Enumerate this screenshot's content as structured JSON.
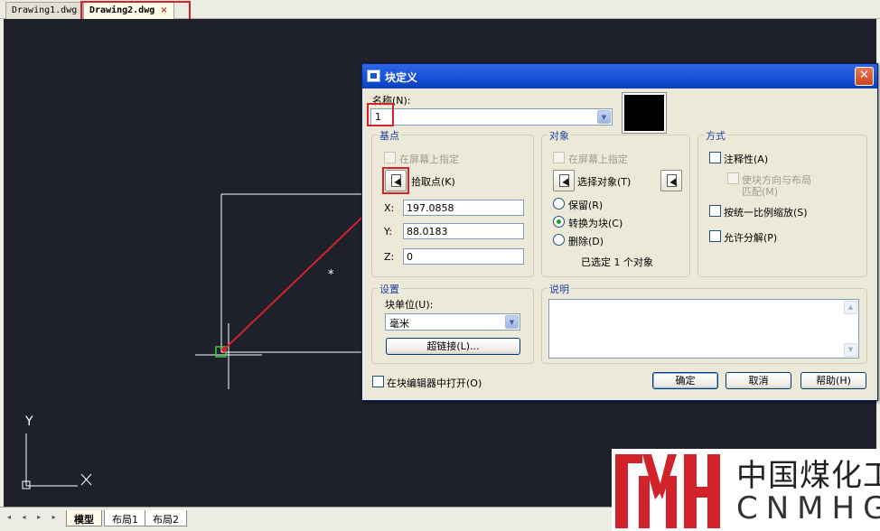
{
  "tabs": [
    {
      "label": "Drawing1.dwg",
      "active": false
    },
    {
      "label": "Drawing2.dwg",
      "active": true
    }
  ],
  "tab_close_glyph": "×",
  "canvas": {
    "ucs_y": "Y",
    "ucs_x": "X",
    "background": "#1e202c"
  },
  "layout_tabs": [
    "模型",
    "布局1",
    "布局2"
  ],
  "layout_nav": "◂ ◂ ▸ ▸",
  "dialog": {
    "title": "块定义",
    "close_glyph": "✕",
    "name_label": "名称(N):",
    "name_value": "1",
    "base_point": {
      "group_label": "基点",
      "specify_on_screen": "在屏幕上指定",
      "pick_point": "拾取点(K)",
      "x_label": "X:",
      "x_value": "197.0858",
      "y_label": "Y:",
      "y_value": "88.0183",
      "z_label": "Z:",
      "z_value": "0"
    },
    "objects": {
      "group_label": "对象",
      "specify_on_screen": "在屏幕上指定",
      "select_objects": "选择对象(T)",
      "retain": "保留(R)",
      "convert_to_block": "转换为块(C)",
      "delete": "删除(D)",
      "selected_count": "已选定 1 个对象"
    },
    "behavior": {
      "group_label": "方式",
      "annotative": "注释性(A)",
      "match_orientation_line1": "使块方向与布局",
      "match_orientation_line2": "匹配(M)",
      "scale_uniformly": "按统一比例缩放(S)",
      "allow_exploding": "允许分解(P)"
    },
    "settings": {
      "group_label": "设置",
      "block_unit_label": "块单位(U):",
      "block_unit_value": "毫米",
      "hyperlink_button": "超链接(L)..."
    },
    "description": {
      "group_label": "说明"
    },
    "open_in_editor": "在块编辑器中打开(O)",
    "ok": "确定",
    "cancel": "取消",
    "help": "帮助(H)"
  },
  "watermark": {
    "cn": "中国煤化工",
    "en": "CNMHG"
  },
  "colors": {
    "accent_red": "#d2232a",
    "title_blue": "#1550d6",
    "group_label": "#1e3ea0"
  }
}
